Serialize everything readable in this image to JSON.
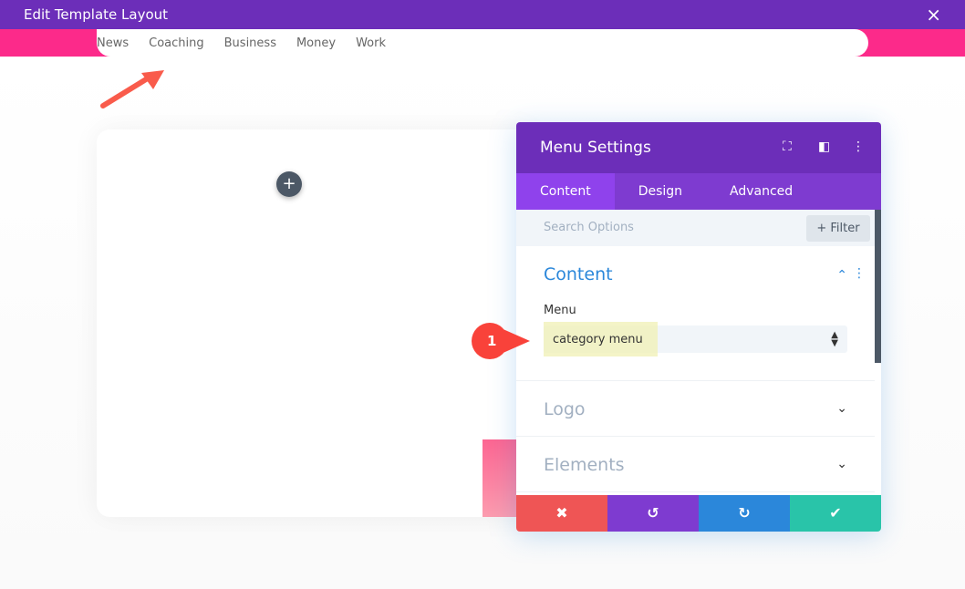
{
  "window": {
    "title": "Edit Template Layout",
    "close_icon": "×"
  },
  "nav": {
    "items": [
      "News",
      "Coaching",
      "Business",
      "Money",
      "Work"
    ]
  },
  "canvas": {
    "add_icon": "+"
  },
  "panel": {
    "title": "Menu Settings",
    "tabs": [
      "Content",
      "Design",
      "Advanced"
    ],
    "search_placeholder": "Search Options",
    "filter_label": "+ Filter",
    "sections": {
      "content": {
        "title": "Content",
        "field_label": "Menu",
        "field_value": "category menu"
      },
      "logo": {
        "title": "Logo"
      },
      "elements": {
        "title": "Elements"
      }
    },
    "footer_colors": [
      "#ef5555",
      "#7e3bd0",
      "#2b87da",
      "#29c4a9"
    ]
  },
  "annotation": {
    "step": "1",
    "color": "#f9423a"
  }
}
